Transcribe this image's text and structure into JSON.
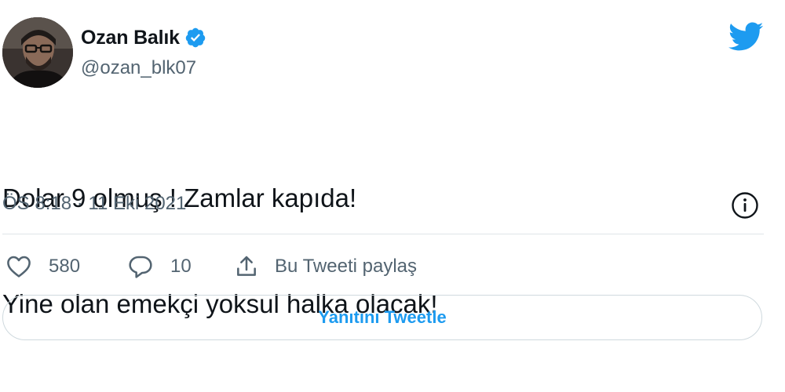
{
  "author": {
    "display_name": "Ozan Balık",
    "handle": "@ozan_blk07",
    "verified": true
  },
  "tweet": {
    "lines": [
      "Dolar 9 olmuş ! Zamlar kapıda!",
      "Yine olan emekçi yoksul halka olacak!"
    ],
    "timestamp": "ÖS 8:18 · 11 Eki 2021"
  },
  "actions": {
    "like_count": "580",
    "reply_count": "10",
    "share_label": "Bu Tweeti paylaş"
  },
  "reply_button": {
    "label": "Yanıtını Tweetle"
  },
  "icons": {
    "brand": "twitter-bird-icon",
    "verified": "verified-badge-icon",
    "info": "info-icon",
    "like": "heart-icon",
    "reply": "comment-bubble-icon",
    "share": "share-upload-icon"
  },
  "colors": {
    "accent": "#1d9bf0",
    "text_primary": "#0f1419",
    "text_secondary": "#536471",
    "divider": "#dfe4e8"
  }
}
